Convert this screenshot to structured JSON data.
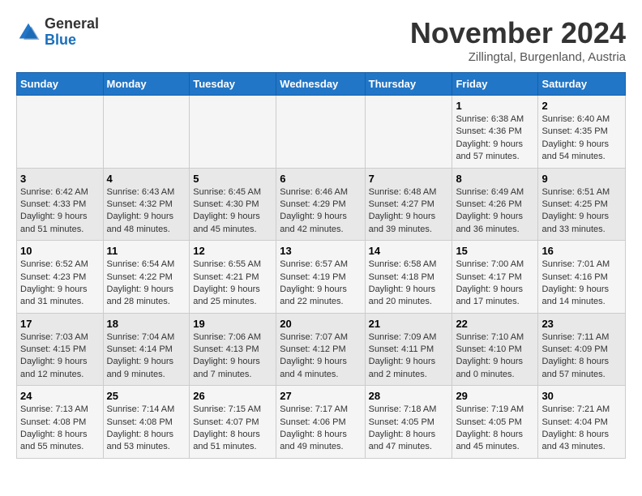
{
  "header": {
    "logo_general": "General",
    "logo_blue": "Blue",
    "month_title": "November 2024",
    "location": "Zillingtal, Burgenland, Austria"
  },
  "columns": [
    "Sunday",
    "Monday",
    "Tuesday",
    "Wednesday",
    "Thursday",
    "Friday",
    "Saturday"
  ],
  "weeks": [
    {
      "days": [
        {
          "num": "",
          "info": ""
        },
        {
          "num": "",
          "info": ""
        },
        {
          "num": "",
          "info": ""
        },
        {
          "num": "",
          "info": ""
        },
        {
          "num": "",
          "info": ""
        },
        {
          "num": "1",
          "info": "Sunrise: 6:38 AM\nSunset: 4:36 PM\nDaylight: 9 hours and 57 minutes."
        },
        {
          "num": "2",
          "info": "Sunrise: 6:40 AM\nSunset: 4:35 PM\nDaylight: 9 hours and 54 minutes."
        }
      ]
    },
    {
      "days": [
        {
          "num": "3",
          "info": "Sunrise: 6:42 AM\nSunset: 4:33 PM\nDaylight: 9 hours and 51 minutes."
        },
        {
          "num": "4",
          "info": "Sunrise: 6:43 AM\nSunset: 4:32 PM\nDaylight: 9 hours and 48 minutes."
        },
        {
          "num": "5",
          "info": "Sunrise: 6:45 AM\nSunset: 4:30 PM\nDaylight: 9 hours and 45 minutes."
        },
        {
          "num": "6",
          "info": "Sunrise: 6:46 AM\nSunset: 4:29 PM\nDaylight: 9 hours and 42 minutes."
        },
        {
          "num": "7",
          "info": "Sunrise: 6:48 AM\nSunset: 4:27 PM\nDaylight: 9 hours and 39 minutes."
        },
        {
          "num": "8",
          "info": "Sunrise: 6:49 AM\nSunset: 4:26 PM\nDaylight: 9 hours and 36 minutes."
        },
        {
          "num": "9",
          "info": "Sunrise: 6:51 AM\nSunset: 4:25 PM\nDaylight: 9 hours and 33 minutes."
        }
      ]
    },
    {
      "days": [
        {
          "num": "10",
          "info": "Sunrise: 6:52 AM\nSunset: 4:23 PM\nDaylight: 9 hours and 31 minutes."
        },
        {
          "num": "11",
          "info": "Sunrise: 6:54 AM\nSunset: 4:22 PM\nDaylight: 9 hours and 28 minutes."
        },
        {
          "num": "12",
          "info": "Sunrise: 6:55 AM\nSunset: 4:21 PM\nDaylight: 9 hours and 25 minutes."
        },
        {
          "num": "13",
          "info": "Sunrise: 6:57 AM\nSunset: 4:19 PM\nDaylight: 9 hours and 22 minutes."
        },
        {
          "num": "14",
          "info": "Sunrise: 6:58 AM\nSunset: 4:18 PM\nDaylight: 9 hours and 20 minutes."
        },
        {
          "num": "15",
          "info": "Sunrise: 7:00 AM\nSunset: 4:17 PM\nDaylight: 9 hours and 17 minutes."
        },
        {
          "num": "16",
          "info": "Sunrise: 7:01 AM\nSunset: 4:16 PM\nDaylight: 9 hours and 14 minutes."
        }
      ]
    },
    {
      "days": [
        {
          "num": "17",
          "info": "Sunrise: 7:03 AM\nSunset: 4:15 PM\nDaylight: 9 hours and 12 minutes."
        },
        {
          "num": "18",
          "info": "Sunrise: 7:04 AM\nSunset: 4:14 PM\nDaylight: 9 hours and 9 minutes."
        },
        {
          "num": "19",
          "info": "Sunrise: 7:06 AM\nSunset: 4:13 PM\nDaylight: 9 hours and 7 minutes."
        },
        {
          "num": "20",
          "info": "Sunrise: 7:07 AM\nSunset: 4:12 PM\nDaylight: 9 hours and 4 minutes."
        },
        {
          "num": "21",
          "info": "Sunrise: 7:09 AM\nSunset: 4:11 PM\nDaylight: 9 hours and 2 minutes."
        },
        {
          "num": "22",
          "info": "Sunrise: 7:10 AM\nSunset: 4:10 PM\nDaylight: 9 hours and 0 minutes."
        },
        {
          "num": "23",
          "info": "Sunrise: 7:11 AM\nSunset: 4:09 PM\nDaylight: 8 hours and 57 minutes."
        }
      ]
    },
    {
      "days": [
        {
          "num": "24",
          "info": "Sunrise: 7:13 AM\nSunset: 4:08 PM\nDaylight: 8 hours and 55 minutes."
        },
        {
          "num": "25",
          "info": "Sunrise: 7:14 AM\nSunset: 4:08 PM\nDaylight: 8 hours and 53 minutes."
        },
        {
          "num": "26",
          "info": "Sunrise: 7:15 AM\nSunset: 4:07 PM\nDaylight: 8 hours and 51 minutes."
        },
        {
          "num": "27",
          "info": "Sunrise: 7:17 AM\nSunset: 4:06 PM\nDaylight: 8 hours and 49 minutes."
        },
        {
          "num": "28",
          "info": "Sunrise: 7:18 AM\nSunset: 4:05 PM\nDaylight: 8 hours and 47 minutes."
        },
        {
          "num": "29",
          "info": "Sunrise: 7:19 AM\nSunset: 4:05 PM\nDaylight: 8 hours and 45 minutes."
        },
        {
          "num": "30",
          "info": "Sunrise: 7:21 AM\nSunset: 4:04 PM\nDaylight: 8 hours and 43 minutes."
        }
      ]
    }
  ]
}
